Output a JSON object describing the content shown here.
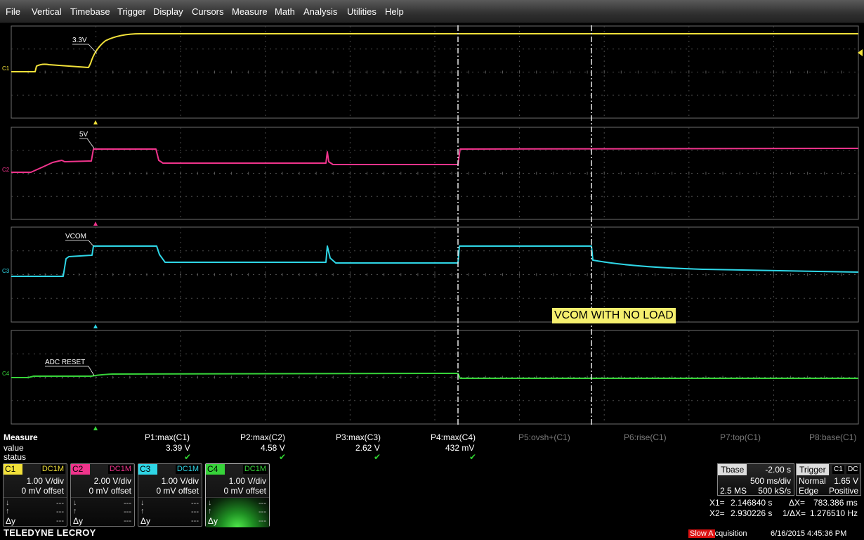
{
  "menu": [
    "File",
    "Vertical",
    "Timebase",
    "Trigger",
    "Display",
    "Cursors",
    "Measure",
    "Math",
    "Analysis",
    "Utilities",
    "Help"
  ],
  "channels": [
    {
      "id": "C1",
      "color": "#f2e13a",
      "annotation": "3.3V"
    },
    {
      "id": "C2",
      "color": "#f0348c",
      "annotation": "5V"
    },
    {
      "id": "C3",
      "color": "#2fd6e6",
      "annotation": "VCOM"
    },
    {
      "id": "C4",
      "color": "#37d43a",
      "annotation": "ADC RESET"
    }
  ],
  "note": {
    "text": "VCOM WITH NO LOAD",
    "bg": "#f5ef6e"
  },
  "measure": {
    "title": "Measure",
    "row_value": "value",
    "row_status": "status",
    "params": [
      {
        "name": "P1:max(C1)",
        "value": "3.39 V",
        "check": "✔"
      },
      {
        "name": "P2:max(C2)",
        "value": "4.58 V",
        "check": "✔"
      },
      {
        "name": "P3:max(C3)",
        "value": "2.62 V",
        "check": "✔"
      },
      {
        "name": "P4:max(C4)",
        "value": "432 mV",
        "check": "✔"
      },
      {
        "name": "P5:ovsh+(C1)",
        "value": "",
        "check": ""
      },
      {
        "name": "P6:rise(C1)",
        "value": "",
        "check": ""
      },
      {
        "name": "P7:top(C1)",
        "value": "",
        "check": ""
      },
      {
        "name": "P8:base(C1)",
        "value": "",
        "check": ""
      }
    ]
  },
  "descriptors": [
    {
      "tag": "C1",
      "coupling": "DC1M",
      "vdiv": "1.00 V/div",
      "offset": "0 mV offset"
    },
    {
      "tag": "C2",
      "coupling": "DC1M",
      "vdiv": "2.00 V/div",
      "offset": "0 mV offset"
    },
    {
      "tag": "C3",
      "coupling": "DC1M",
      "vdiv": "1.00 V/div",
      "offset": "0 mV offset"
    },
    {
      "tag": "C4",
      "coupling": "DC1M",
      "vdiv": "1.00 V/div",
      "offset": "0 mV offset"
    }
  ],
  "descriptor_sub": {
    "arrow_down": "↓",
    "arrow_up": "↑",
    "dy": "Δy",
    "dash": "---"
  },
  "timebase": {
    "label": "Tbase",
    "delay": "-2.00 s",
    "tdiv": "500 ms/div",
    "samples": "2.5 MS",
    "rate": "500 kS/s"
  },
  "trigger": {
    "label": "Trigger",
    "src": "C1",
    "coupling": "DC",
    "mode": "Normal",
    "level": "1.65 V",
    "type": "Edge",
    "slope": "Positive"
  },
  "cursors": {
    "x1_label": "X1=",
    "x1": "2.146840 s",
    "dx_label": "ΔX=",
    "dx": "783.386 ms",
    "x2_label": "X2=",
    "x2": "2.930226 s",
    "inv_label": "1/ΔX=",
    "inv": "1.276510 Hz"
  },
  "acquisition": {
    "slow": "Slow A",
    "rest": "cquisition"
  },
  "datetime": "6/16/2015 4:45:36 PM",
  "brand": "TELEDYNE LECROY"
}
